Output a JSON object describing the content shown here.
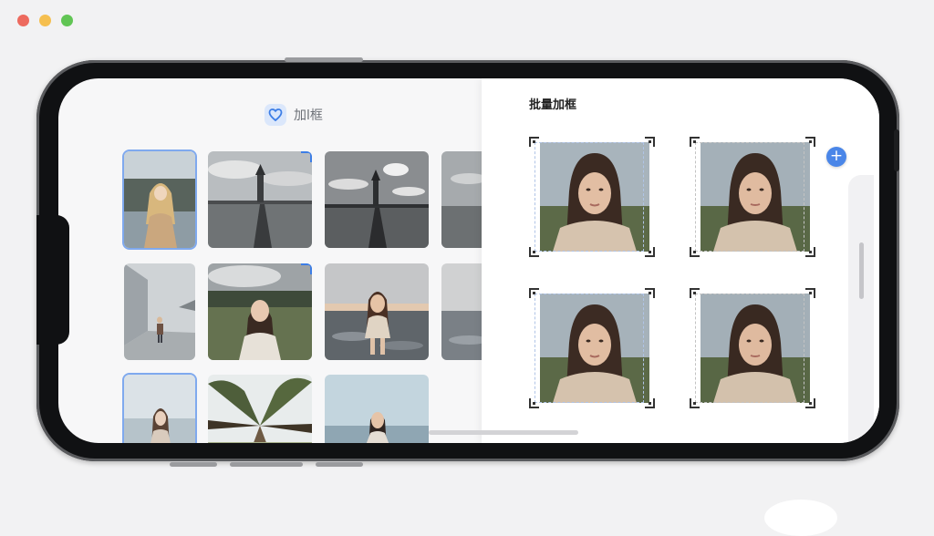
{
  "window": {
    "traffic_lights": [
      "#ed6a5e",
      "#f5bf4f",
      "#61c554"
    ]
  },
  "app": {
    "title": "加l框",
    "icon": "heart-shield-icon",
    "accent": "#3d7ee6"
  },
  "gallery": {
    "rows": [
      [
        {
          "subject": "blonde-woman-lake",
          "selected": true
        },
        {
          "subject": "lighthouse-pier",
          "selected": false,
          "marked": true
        },
        {
          "subject": "lighthouse-pier-bw",
          "selected": false
        },
        {
          "subject": "lake-partial",
          "selected": false
        }
      ],
      [
        {
          "subject": "building-walkway",
          "selected": false
        },
        {
          "subject": "woman-field",
          "selected": false,
          "marked": true
        },
        {
          "subject": "woman-beach",
          "selected": false
        },
        {
          "subject": "beach-partial",
          "selected": false
        }
      ],
      [
        {
          "subject": "woman-misty",
          "selected": true
        },
        {
          "subject": "trees-upward",
          "selected": false
        },
        {
          "subject": "woman-sea-sky",
          "selected": false
        }
      ]
    ]
  },
  "batch_panel": {
    "title": "批量加框",
    "add_button_label": "+",
    "frames": [
      {
        "style": "blue-dashed"
      },
      {
        "style": "grey-dashed"
      },
      {
        "style": "blue-dashed"
      },
      {
        "style": "grey-dashed"
      }
    ]
  }
}
